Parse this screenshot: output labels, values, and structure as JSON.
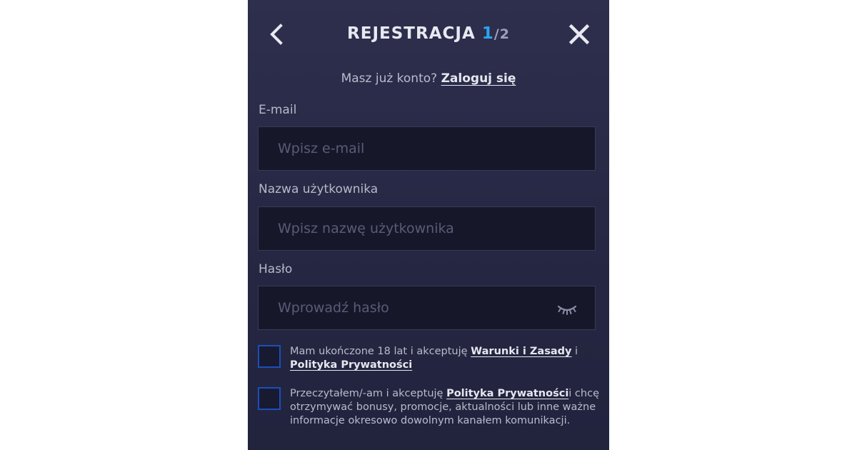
{
  "header": {
    "title": "REJESTRACJA",
    "step_current": "1",
    "step_total": "/2",
    "back_icon": "chevron-left-icon",
    "close_icon": "close-icon"
  },
  "login_prompt": {
    "text": "Masz już konto?",
    "link": "Zaloguj się"
  },
  "form": {
    "email": {
      "label": "E-mail",
      "placeholder": "Wpisz e-mail",
      "value": ""
    },
    "username": {
      "label": "Nazwa użytkownika",
      "placeholder": "Wpisz nazwę użytkownika",
      "value": ""
    },
    "password": {
      "label": "Hasło",
      "placeholder": "Wprowadź hasło",
      "value": "",
      "toggle_icon": "eye-closed-icon"
    }
  },
  "consents": [
    {
      "checked": false,
      "text_before": "Mam ukończone 18 lat i akceptuję ",
      "link1": "Warunki i Zasady",
      "text_middle": " i ",
      "link2": "Polityka Prywatności",
      "text_after": ""
    },
    {
      "checked": false,
      "text_before": "Przeczytałem/-am i akceptuję ",
      "link1": "Polityka Prywatności",
      "text_after": "i chcę otrzymywać bonusy, promocje, aktualności lub inne ważne informacje okresowo dowolnym kanałem komunikacji."
    }
  ],
  "colors": {
    "panel_bg": "#2a2c49",
    "accent_step": "#2ea3ef",
    "checkbox_border": "#1b4fb8",
    "input_bg": "#161729"
  }
}
